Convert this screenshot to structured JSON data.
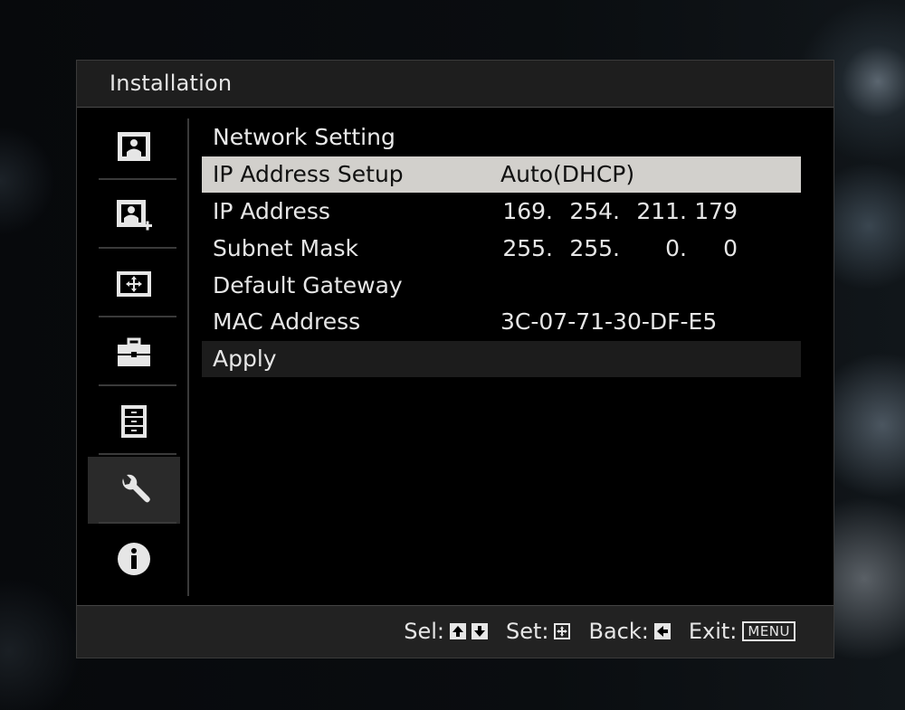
{
  "window": {
    "title": "Installation"
  },
  "sidebar": {
    "items": [
      {
        "icon": "picture-icon",
        "active": false
      },
      {
        "icon": "picture-plus-icon",
        "active": false
      },
      {
        "icon": "screen-adjust-icon",
        "active": false
      },
      {
        "icon": "toolbox-icon",
        "active": false
      },
      {
        "icon": "list-icon",
        "active": false
      },
      {
        "icon": "wrench-icon",
        "active": true
      },
      {
        "icon": "info-icon",
        "active": false
      }
    ]
  },
  "main": {
    "section_title": "Network Setting",
    "ip_setup": {
      "label": "IP Address Setup",
      "value": "Auto(DHCP)"
    },
    "ip_address": {
      "label": "IP Address",
      "octets": [
        "169.",
        "254.",
        "211.",
        "179"
      ]
    },
    "subnet_mask": {
      "label": "Subnet Mask",
      "octets": [
        "255.",
        "255.",
        "0.",
        "0"
      ]
    },
    "default_gateway": {
      "label": "Default Gateway",
      "value": ""
    },
    "mac_address": {
      "label": "MAC Address",
      "value": "3C-07-71-30-DF-E5"
    },
    "apply": {
      "label": "Apply"
    }
  },
  "footer": {
    "sel_label": "Sel:",
    "set_label": "Set:",
    "back_label": "Back:",
    "exit_label": "Exit:",
    "menu_key": "MENU"
  },
  "colors": {
    "selected_row": "#d2d0cc",
    "panel": "#000000",
    "bar": "#1e1e1e"
  }
}
